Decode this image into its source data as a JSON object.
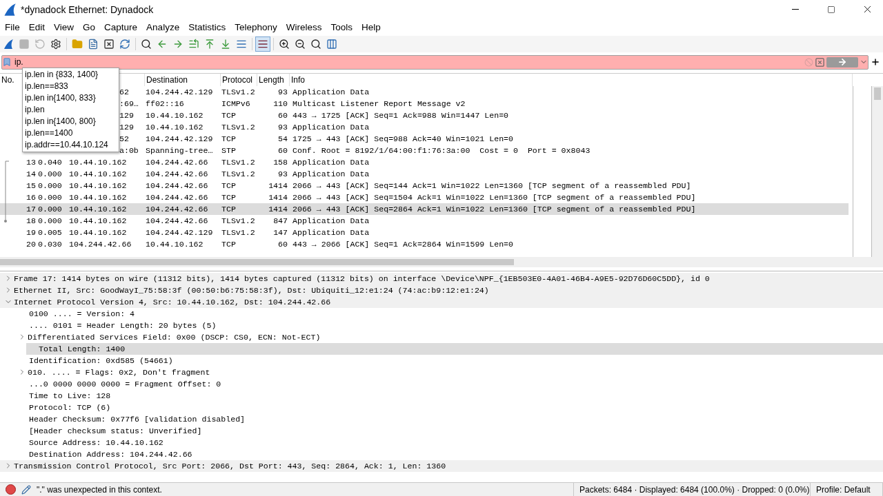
{
  "window": {
    "title": "*dynadock Ethernet: Dynadock"
  },
  "menu": [
    "File",
    "Edit",
    "View",
    "Go",
    "Capture",
    "Analyze",
    "Statistics",
    "Telephony",
    "Wireless",
    "Tools",
    "Help"
  ],
  "toolbar": [
    {
      "kind": "start",
      "disabled": false,
      "pressed": false
    },
    {
      "kind": "stop",
      "disabled": true,
      "pressed": false
    },
    {
      "kind": "restart",
      "disabled": true,
      "pressed": false
    },
    {
      "kind": "options",
      "disabled": false,
      "pressed": false
    },
    {
      "kind": "separator"
    },
    {
      "kind": "open",
      "disabled": false,
      "pressed": false
    },
    {
      "kind": "save",
      "disabled": false,
      "pressed": false
    },
    {
      "kind": "close",
      "disabled": false,
      "pressed": false
    },
    {
      "kind": "reload",
      "disabled": false,
      "pressed": false
    },
    {
      "kind": "separator"
    },
    {
      "kind": "find",
      "disabled": false,
      "pressed": false
    },
    {
      "kind": "back",
      "disabled": false,
      "pressed": false
    },
    {
      "kind": "forward",
      "disabled": false,
      "pressed": false
    },
    {
      "kind": "goto",
      "disabled": false,
      "pressed": false
    },
    {
      "kind": "first",
      "disabled": false,
      "pressed": false
    },
    {
      "kind": "last",
      "disabled": false,
      "pressed": false
    },
    {
      "kind": "autoscroll",
      "disabled": false,
      "pressed": false
    },
    {
      "kind": "separator"
    },
    {
      "kind": "colorize",
      "disabled": false,
      "pressed": true
    },
    {
      "kind": "separator"
    },
    {
      "kind": "zoom_in",
      "disabled": false,
      "pressed": false
    },
    {
      "kind": "zoom_out",
      "disabled": false,
      "pressed": false
    },
    {
      "kind": "normal_size",
      "disabled": false,
      "pressed": false
    },
    {
      "kind": "resize_columns",
      "disabled": false,
      "pressed": false
    }
  ],
  "filter": {
    "value": "ip.",
    "valid": false
  },
  "autocomplete": [
    "ip.len in {833, 1400}",
    "ip.len==833",
    "ip.len in{1400, 833}",
    "ip.len",
    "ip.len in{1400, 800}",
    "ip.len==1400",
    "ip.addr==10.44.10.124"
  ],
  "packet_list": {
    "columns": [
      "No.",
      "Destination",
      "Protocol",
      "Length",
      "Info"
    ],
    "rows": [
      {
        "source": "62",
        "destination": "104.244.42.129",
        "protocol": "TLSv1.2",
        "length": "93",
        "info": "Application Data",
        "selected": false
      },
      {
        "source": ":69…",
        "destination": "ff02::16",
        "protocol": "ICMPv6",
        "length": "110",
        "info": "Multicast Listener Report Message v2",
        "selected": false
      },
      {
        "source": "129",
        "destination": "10.44.10.162",
        "protocol": "TCP",
        "length": "60",
        "info": "443 → 1725 [ACK] Seq=1 Ack=988 Win=1447 Len=0",
        "selected": false
      },
      {
        "source": "129",
        "destination": "10.44.10.162",
        "protocol": "TLSv1.2",
        "length": "93",
        "info": "Application Data",
        "selected": false
      },
      {
        "source": "52",
        "destination": "104.244.42.129",
        "protocol": "TCP",
        "length": "54",
        "info": "1725 → 443 [ACK] Seq=988 Ack=40 Win=1021 Len=0",
        "selected": false
      },
      {
        "source": "a:0b",
        "destination": "Spanning-tree…",
        "protocol": "STP",
        "length": "60",
        "info": "Conf. Root = 8192/1/64:00:f1:76:3a:00  Cost = 0  Port = 0x8043",
        "selected": false
      },
      {
        "no": "13",
        "time": "0.040",
        "source": "10.44.10.162",
        "destination": "104.244.42.66",
        "protocol": "TLSv1.2",
        "length": "158",
        "info": "Application Data",
        "selected": false
      },
      {
        "no": "14",
        "time": "0.000",
        "source": "10.44.10.162",
        "destination": "104.244.42.66",
        "protocol": "TLSv1.2",
        "length": "93",
        "info": "Application Data",
        "selected": false
      },
      {
        "no": "15",
        "time": "0.000",
        "source": "10.44.10.162",
        "destination": "104.244.42.66",
        "protocol": "TCP",
        "length": "1414",
        "info": "2066 → 443 [ACK] Seq=144 Ack=1 Win=1022 Len=1360 [TCP segment of a reassembled PDU]",
        "selected": false
      },
      {
        "no": "16",
        "time": "0.000",
        "source": "10.44.10.162",
        "destination": "104.244.42.66",
        "protocol": "TCP",
        "length": "1414",
        "info": "2066 → 443 [ACK] Seq=1504 Ack=1 Win=1022 Len=1360 [TCP segment of a reassembled PDU]",
        "selected": false
      },
      {
        "no": "17",
        "time": "0.000",
        "source": "10.44.10.162",
        "destination": "104.244.42.66",
        "protocol": "TCP",
        "length": "1414",
        "info": "2066 → 443 [ACK] Seq=2864 Ack=1 Win=1022 Len=1360 [TCP segment of a reassembled PDU]",
        "selected": true
      },
      {
        "no": "18",
        "time": "0.000",
        "source": "10.44.10.162",
        "destination": "104.244.42.66",
        "protocol": "TLSv1.2",
        "length": "847",
        "info": "Application Data",
        "selected": false
      },
      {
        "no": "19",
        "time": "0.005",
        "source": "10.44.10.162",
        "destination": "104.244.42.129",
        "protocol": "TLSv1.2",
        "length": "147",
        "info": "Application Data",
        "selected": false
      },
      {
        "no": "20",
        "time": "0.030",
        "source": "104.244.42.66",
        "destination": "10.44.10.162",
        "protocol": "TCP",
        "length": "60",
        "info": "443 → 2066 [ACK] Seq=1 Ack=2864 Win=1599 Len=0",
        "selected": false
      }
    ]
  },
  "details": [
    {
      "text": "Frame 17: 1414 bytes on wire (11312 bits), 1414 bytes captured (11312 bits) on interface \\Device\\NPF_{1EB503E0-4A01-46B4-A9E5-92D76D60C5DD}, id 0",
      "expanded": false,
      "selected": false
    },
    {
      "text": "Ethernet II, Src: GoodWayI_75:58:3f (00:50:b6:75:58:3f), Dst: Ubiquiti_12:e1:24 (74:ac:b9:12:e1:24)",
      "expanded": false,
      "selected": false
    },
    {
      "text": "Internet Protocol Version 4, Src: 10.44.10.162, Dst: 104.244.42.66",
      "expanded": true,
      "selected": false,
      "children": [
        {
          "text": "0100 .... = Version: 4",
          "selected": false
        },
        {
          "text": ".... 0101 = Header Length: 20 bytes (5)",
          "selected": false
        },
        {
          "text": "Differentiated Services Field: 0x00 (DSCP: CS0, ECN: Not-ECT)",
          "expanded": false,
          "selected": false
        },
        {
          "text": "Total Length: 1400",
          "selected": true
        },
        {
          "text": "Identification: 0xd585 (54661)",
          "selected": false
        },
        {
          "text": "010. .... = Flags: 0x2, Don't fragment",
          "expanded": false,
          "selected": false
        },
        {
          "text": "...0 0000 0000 0000 = Fragment Offset: 0",
          "selected": false
        },
        {
          "text": "Time to Live: 128",
          "selected": false
        },
        {
          "text": "Protocol: TCP (6)",
          "selected": false
        },
        {
          "text": "Header Checksum: 0x77f6 [validation disabled]",
          "selected": false
        },
        {
          "text": "[Header checksum status: Unverified]",
          "selected": false
        },
        {
          "text": "Source Address: 10.44.10.162",
          "selected": false
        },
        {
          "text": "Destination Address: 104.244.42.66",
          "selected": false
        }
      ]
    },
    {
      "text": "Transmission Control Protocol, Src Port: 2066, Dst Port: 443, Seq: 2864, Ack: 1, Len: 1360",
      "expanded": false,
      "selected": false
    }
  ],
  "status_bar": {
    "message": "\".\" was unexpected in this context.",
    "packets": "Packets: 6484 · Displayed: 6484 (100.0%) · Dropped: 0 (0.0%)",
    "profile": "Profile: Default"
  }
}
